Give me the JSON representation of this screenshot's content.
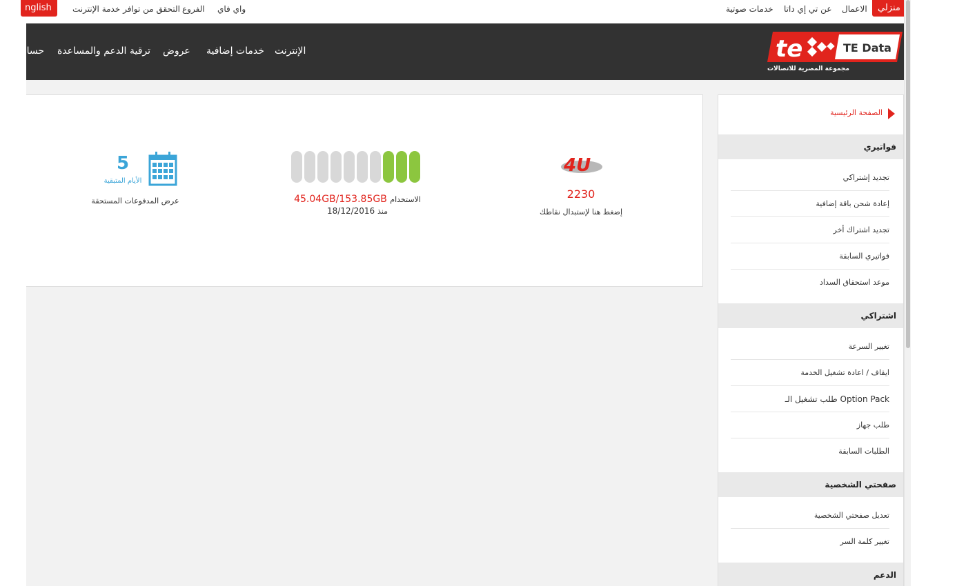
{
  "topbar": {
    "right_links": [
      {
        "id": "home",
        "label": "منزلي"
      },
      {
        "id": "business",
        "label": "الاعمال"
      },
      {
        "id": "about",
        "label": "عن تي إي داتا"
      },
      {
        "id": "voice",
        "label": "خدمات صوتية"
      }
    ],
    "left_links": [
      {
        "id": "wifi",
        "label": "واي فاي"
      },
      {
        "id": "branches",
        "label": "الفروع"
      },
      {
        "id": "coverage",
        "label": "التحقق من توافر خدمة الإنترنت"
      }
    ],
    "language_label": "nglish"
  },
  "header": {
    "logo_text": "TE Data",
    "logo_tagline": "مجموعة المصرية للاتصالات",
    "nav": [
      {
        "id": "internet",
        "label": "الإنترنت"
      },
      {
        "id": "extra",
        "label": "خدمات إضافية"
      },
      {
        "id": "offers",
        "label": "عروض"
      },
      {
        "id": "upgrade",
        "label": "ترقية"
      },
      {
        "id": "support",
        "label": "الدعم والمساعدة"
      },
      {
        "id": "account",
        "label": "حسابي"
      }
    ]
  },
  "card": {
    "points": {
      "logo_text": "4U",
      "value": "2230",
      "label": "إضغط هنا لإستبدال نقاطك"
    },
    "usage": {
      "prefix": "الاستخدام",
      "value": "45.04GB/153.85GB",
      "since_label": "منذ",
      "since_date": "18/12/2016",
      "bars_total": 10,
      "bars_used": 3,
      "used_color": "#8cc63f",
      "empty_color": "#d8d8d8"
    },
    "days": {
      "value": "5",
      "label": "الأيام المتبقية",
      "link": "عرض المدفوعات المستحقة",
      "color": "#3ba5d8"
    }
  },
  "sidebar": {
    "home": "الصفحة الرئيسية",
    "sections": [
      {
        "title": "فواتيري",
        "items": [
          "تجديد إشتراكي",
          "إعادة شحن باقة إضافية",
          "تجديد اشتراك أخر",
          "فواتيري السابقة",
          "موعد استحقاق السداد"
        ]
      },
      {
        "title": "اشتراكي",
        "items": [
          "تغيير السرعة",
          "ايقاف / اعادة تشغيل الخدمة",
          "طلب تشغيل الـ Option Pack",
          "طلب جهاز",
          "الطلبات السابقة"
        ]
      },
      {
        "title": "صفحتي الشخصية",
        "items": [
          "تعديل صفحتي الشخصية",
          "تغيير كلمة السر"
        ]
      },
      {
        "title": "الدعم",
        "items": []
      }
    ]
  },
  "colors": {
    "brand_red": "#e1241d",
    "header_bg": "#323232",
    "points_red": "#e1241d"
  }
}
